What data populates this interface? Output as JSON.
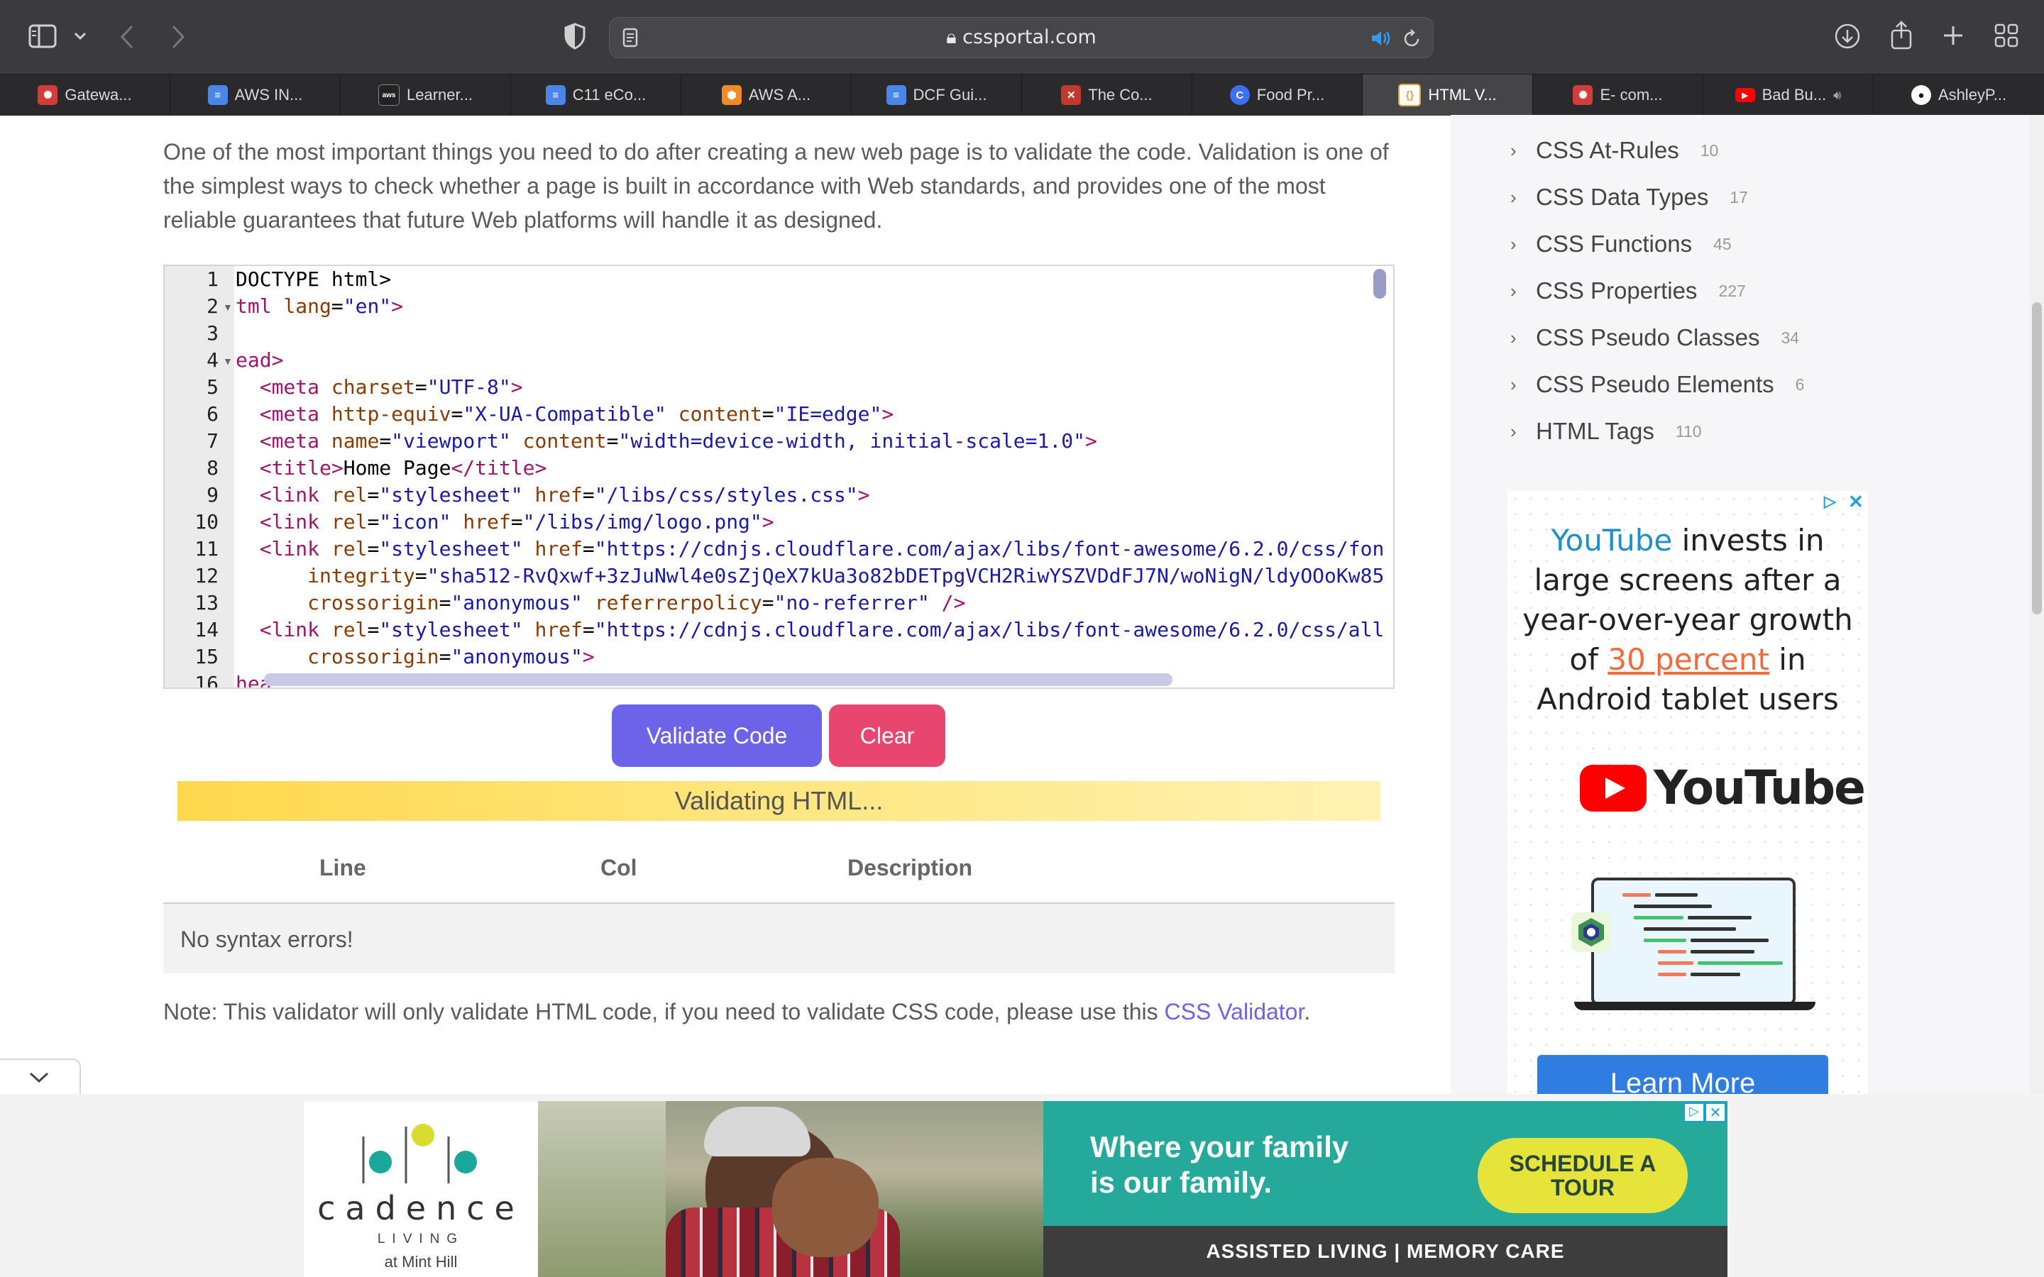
{
  "browser": {
    "address": "cssportal.com",
    "tabs": [
      {
        "label": "Gatewa...",
        "icon": "red-logo",
        "color": "#d43c3c"
      },
      {
        "label": "AWS IN...",
        "icon": "docs",
        "color": "#4a86e8"
      },
      {
        "label": "Learner...",
        "icon": "aws",
        "color": "#222222"
      },
      {
        "label": "C11 eCo...",
        "icon": "docs",
        "color": "#4a86e8"
      },
      {
        "label": "AWS A...",
        "icon": "aws-box",
        "color": "#f08a24"
      },
      {
        "label": "DCF Gui...",
        "icon": "docs",
        "color": "#4a86e8"
      },
      {
        "label": "The Co...",
        "icon": "red-logo",
        "color": "#c0392b"
      },
      {
        "label": "Food Pr...",
        "icon": "canva",
        "color": "#3b6ff5"
      },
      {
        "label": "HTML V...",
        "icon": "cssportal",
        "color": "#e8a33c"
      },
      {
        "label": "E- com...",
        "icon": "red-logo",
        "color": "#d43c3c"
      },
      {
        "label": "Bad Bu...",
        "icon": "youtube",
        "color": "#ff0000"
      },
      {
        "label": "AshleyP...",
        "icon": "github",
        "color": "#ffffff"
      }
    ]
  },
  "content": {
    "intro": "One of the most important things you need to do after creating a new web page is to validate the code. Validation is one of the simplest ways to check whether a page is built in accordance with Web standards, and provides one of the most reliable guarantees that future Web platforms will handle it as designed.",
    "line_numbers": [
      "1",
      "2",
      "3",
      "4",
      "5",
      "6",
      "7",
      "8",
      "9",
      "10",
      "11",
      "12",
      "13",
      "14",
      "15",
      "16"
    ],
    "buttons": {
      "validate": "Validate Code",
      "clear": "Clear"
    },
    "status": "Validating HTML...",
    "table": {
      "headers": [
        "Line",
        "Col",
        "Description"
      ],
      "result": "No syntax errors!"
    },
    "note_prefix": "Note: This validator will only validate HTML code, if you need to validate CSS code, please use this ",
    "note_link": "CSS Validator",
    "note_suffix": "."
  },
  "sidebar": {
    "items": [
      {
        "label": "CSS At-Rules",
        "count": "10"
      },
      {
        "label": "CSS Data Types",
        "count": "17"
      },
      {
        "label": "CSS Functions",
        "count": "45"
      },
      {
        "label": "CSS Properties",
        "count": "227"
      },
      {
        "label": "CSS Pseudo Classes",
        "count": "34"
      },
      {
        "label": "CSS Pseudo Elements",
        "count": "6"
      },
      {
        "label": "HTML Tags",
        "count": "110"
      }
    ]
  },
  "side_ad": {
    "brand_word": "YouTube",
    "line1": "invests in large screens after a year-over-year growth of",
    "highlight": "30 percent",
    "line2": "in Android tablet users",
    "logo_text": "YouTube",
    "button": "Learn More"
  },
  "banner_ad": {
    "logo_name": "cadence",
    "logo_sub": "LIVING",
    "logo_location": "at Mint Hill",
    "headline1": "Where your family",
    "headline2": "is our family.",
    "cta": "SCHEDULE A TOUR",
    "footer": "ASSISTED LIVING | MEMORY CARE"
  }
}
